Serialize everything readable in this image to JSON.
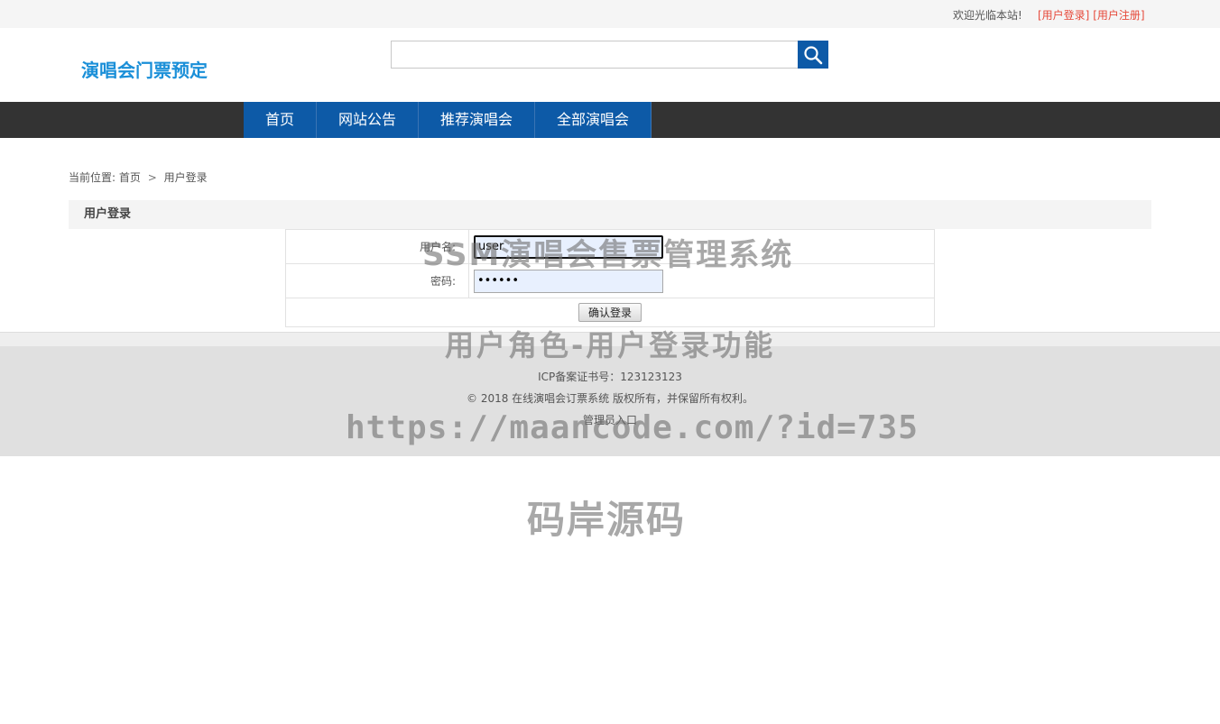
{
  "topbar": {
    "welcome": "欢迎光临本站!",
    "login_link": "[用户登录]",
    "register_link": "[用户注册]"
  },
  "header": {
    "logo_text": "演唱会门票预定",
    "search_placeholder": "",
    "search_icon": "search-icon"
  },
  "nav": {
    "items": [
      {
        "label": "首页"
      },
      {
        "label": "网站公告"
      },
      {
        "label": "推荐演唱会"
      },
      {
        "label": "全部演唱会"
      }
    ]
  },
  "breadcrumb": {
    "prefix": "当前位置:",
    "home": "首页",
    "separator": ">",
    "current": "用户登录"
  },
  "login": {
    "title": "用户登录",
    "username_label": "用户名:",
    "username_value": "user",
    "password_label": "密码:",
    "password_value": "••••••",
    "submit_label": "确认登录"
  },
  "footer": {
    "icp": "ICP备案证书号：123123123",
    "copyright": "© 2018 在线演唱会订票系统 版权所有，并保留所有权利。",
    "admin_link": "管理员入口"
  },
  "watermarks": {
    "line1": "SSM演唱会售票管理系统",
    "line2": "用户角色-用户登录功能",
    "line3": "https://maancode.com/?id=735",
    "line4": "码岸源码"
  },
  "colors": {
    "accent": "#0d5aa7",
    "nav_bg": "#333333",
    "logo": "#1a8fd8",
    "link_red": "#e64a3b"
  }
}
